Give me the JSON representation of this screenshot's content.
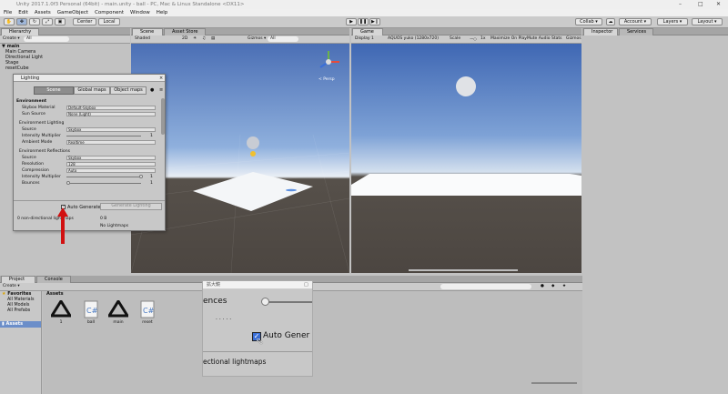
{
  "window": {
    "title": "Unity 2017.1.0f3 Personal (64bit) - main.unity - ball - PC, Mac & Linux Standalone <DX11>"
  },
  "menu": [
    "File",
    "Edit",
    "Assets",
    "GameObject",
    "Component",
    "Window",
    "Help"
  ],
  "toolbar": {
    "center": "Center",
    "local": "Local",
    "collab": "Collab ▾",
    "account": "Account ▾",
    "layers": "Layers ▾",
    "layout": "Layout ▾"
  },
  "hierarchy": {
    "tab": "Hierarchy",
    "create": "Create ▾",
    "search": "All",
    "scene": "main",
    "items": [
      "Main Camera",
      "Directional Light",
      "Stage",
      "resetCube"
    ]
  },
  "scene": {
    "tab_scene": "Scene",
    "tab_store": "Asset Store",
    "shading": "Shaded",
    "mode2d": "2D",
    "gizmos": "Gizmos ▾",
    "search": "All",
    "persp": "< Persp"
  },
  "game": {
    "tab": "Game",
    "display": "Display 1",
    "aspect": "AQUOS yuko (1280x720)",
    "scale_label": "Scale",
    "scale_value": "1x",
    "maximize": "Maximize On Play",
    "mute": "Mute Audio",
    "stats": "Stats",
    "gizmos": "Gizmos"
  },
  "inspector": {
    "tab": "Inspector",
    "services": "Services"
  },
  "lighting": {
    "title": "Lighting",
    "tabs": [
      "Scene",
      "Global maps",
      "Object maps"
    ],
    "environment": "Environment",
    "skybox_label": "Skybox Material",
    "skybox_value": "Default-Skybox",
    "sun_label": "Sun Source",
    "sun_value": "None (Light)",
    "env_lighting": "Environment Lighting",
    "source_label": "Source",
    "source_value": "Skybox",
    "intensity_label": "Intensity Multiplier",
    "intensity_value": "1",
    "ambient_label": "Ambient Mode",
    "ambient_value": "Realtime",
    "env_reflections": "Environment Reflections",
    "r_source_label": "Source",
    "r_source_value": "Skybox",
    "resolution_label": "Resolution",
    "resolution_value": "128",
    "compression_label": "Compression",
    "compression_value": "Auto",
    "r_intensity_label": "Intensity Multiplier",
    "r_intensity_value": "1",
    "bounces_label": "Bounces",
    "bounces_value": "1",
    "auto_generate": "Auto Generate",
    "generate_btn": "Generate Lighting",
    "nondir": "0 non-directional lightmaps",
    "size": "0 B",
    "nolight": "No Lightmaps"
  },
  "project": {
    "tab": "Project",
    "console": "Console",
    "create": "Create ▾",
    "favorites": "Favorites",
    "fav_items": [
      "All Materials",
      "All Models",
      "All Prefabs"
    ],
    "assets_label": "Assets",
    "breadcrumb": "Assets",
    "assets": [
      {
        "name": "1",
        "icon": "unity-icon"
      },
      {
        "name": "ball",
        "icon": "csharp-icon"
      },
      {
        "name": "main",
        "icon": "unity-icon"
      },
      {
        "name": "reset",
        "icon": "csharp-icon"
      }
    ]
  },
  "zoom": {
    "title": "拡大鏡",
    "t1": "ences",
    "t2": ". .  . .  .",
    "t3": "Auto Gener",
    "t4": "ectional lightmaps"
  },
  "colors": {
    "sky_top": "#4b72b8",
    "sky_bottom": "#e6eef6",
    "ground": "#4c4641",
    "arrow": "#d11010",
    "accent": "#3a6fd8"
  }
}
